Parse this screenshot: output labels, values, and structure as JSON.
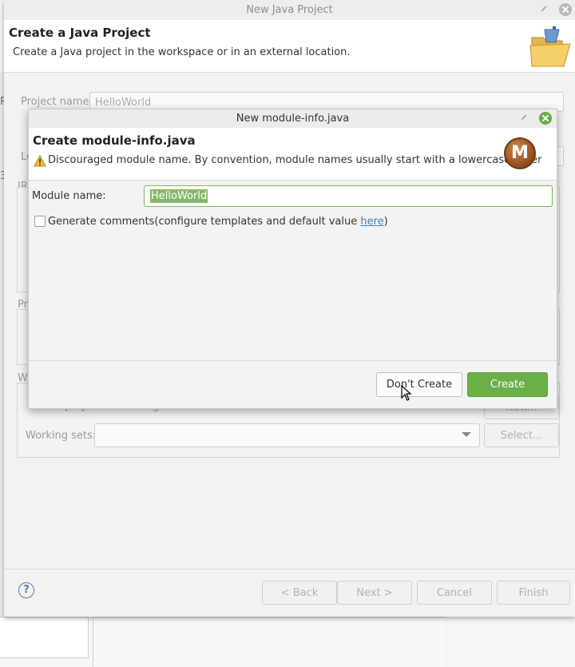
{
  "wizard": {
    "window_title": "New Java Project",
    "header_title": "Create a Java Project",
    "header_description": "Create a Java project in the workspace or in an external location.",
    "project_name_label": "Project name:",
    "project_name_value": "HelloWorld",
    "partial_labels": {
      "location": "Lo",
      "jre": "JR",
      "project_layout": "Pr",
      "working_sets": "Wo",
      "left_edge_r": "R",
      "left_edge_3": "3"
    },
    "add_to_working_sets": "Add project to working sets",
    "new_button": "New...",
    "working_sets_label": "Working sets:",
    "select_button": "Select...",
    "help_symbol": "?",
    "buttons": {
      "back": "< Back",
      "next": "Next >",
      "cancel": "Cancel",
      "finish": "Finish"
    }
  },
  "dialog": {
    "window_title": "New module-info.java",
    "header_title": "Create module-info.java",
    "warning_message": "Discouraged module name. By convention, module names usually start with a lowercase letter",
    "module_icon_letter": "M",
    "module_name_label": "Module name:",
    "module_name_value": "HelloWorld",
    "generate_comments_prefix": "Generate comments(configure templates and default value ",
    "generate_comments_link": "here",
    "generate_comments_suffix": ")",
    "generate_comments_checked": false,
    "buttons": {
      "dont_create": "Don't Create",
      "create": "Create"
    }
  },
  "colors": {
    "accent_green": "#6aaf48",
    "link_blue": "#3f7ab9",
    "warning_yellow": "#f2c230"
  }
}
